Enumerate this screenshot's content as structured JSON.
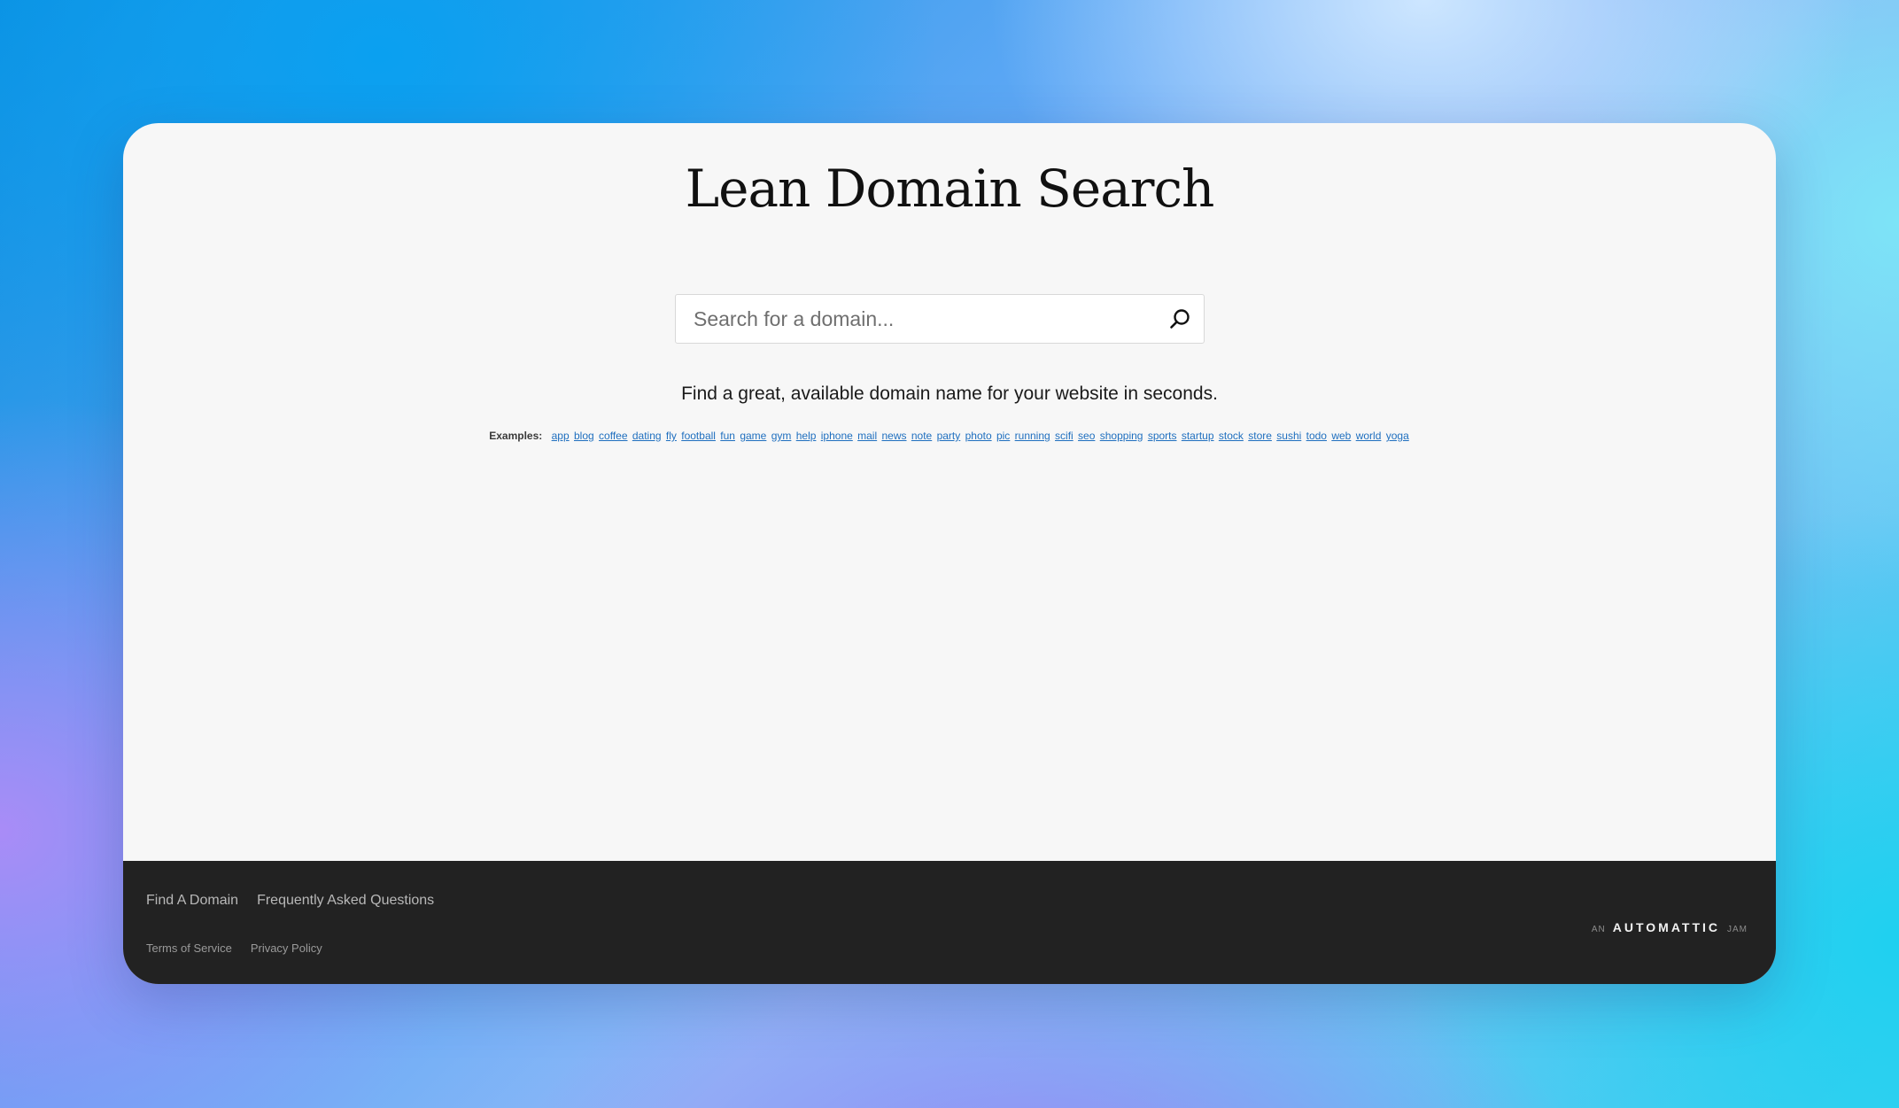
{
  "header": {
    "title": "Lean Domain Search"
  },
  "search": {
    "placeholder": "Search for a domain...",
    "value": "",
    "button_icon": "search-icon"
  },
  "tagline": "Find a great, available domain name for your website in seconds.",
  "examples": {
    "label": "Examples:",
    "items": [
      "app",
      "blog",
      "coffee",
      "dating",
      "fly",
      "football",
      "fun",
      "game",
      "gym",
      "help",
      "iphone",
      "mail",
      "news",
      "note",
      "party",
      "photo",
      "pic",
      "running",
      "scifi",
      "seo",
      "shopping",
      "sports",
      "startup",
      "stock",
      "store",
      "sushi",
      "todo",
      "web",
      "world",
      "yoga"
    ]
  },
  "footer": {
    "nav": [
      "Find A Domain",
      "Frequently Asked Questions"
    ],
    "legal": [
      "Terms of Service",
      "Privacy Policy"
    ],
    "credit": {
      "prefix": "AN",
      "brand": "AUTOMATTIC",
      "suffix": "JAM"
    }
  },
  "colors": {
    "card_background": "#f7f7f7",
    "footer_background": "#222222",
    "link": "#1f6fbf"
  }
}
